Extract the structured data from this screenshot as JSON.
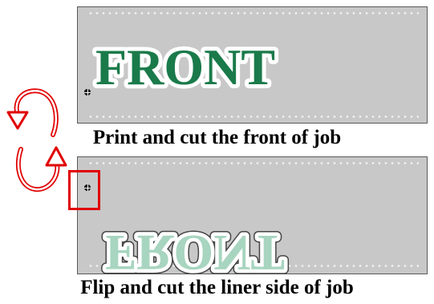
{
  "front_panel": {
    "word": "FRONT",
    "fill_color": "#1a7a4a",
    "outline_color": "#ffffff"
  },
  "back_panel": {
    "word": "FRONT",
    "fill_color": "#a8d5c0",
    "outline_color": "#ffffff",
    "mirrored": true
  },
  "captions": {
    "top": "Print and cut the front of job",
    "bottom": "Flip and cut the liner side of job"
  },
  "colors": {
    "sheet": "#c8c8c8",
    "accent": "#e00000"
  }
}
